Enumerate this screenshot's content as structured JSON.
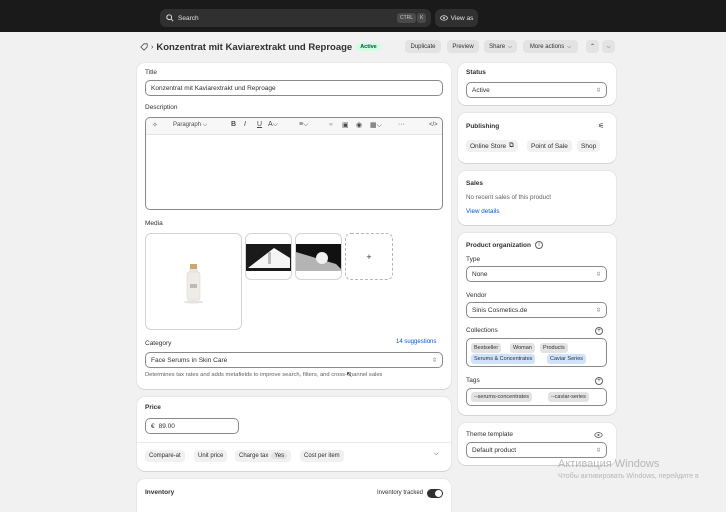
{
  "topbar": {
    "search_placeholder": "Search",
    "shortcut_ctrl": "CTRL",
    "shortcut_k": "K",
    "view_as": "View as"
  },
  "header": {
    "title": "Konzentrat mit Kaviarextrakt und Reproage",
    "status_badge": "Active",
    "duplicate": "Duplicate",
    "preview": "Preview",
    "share": "Share",
    "more_actions": "More actions"
  },
  "main": {
    "title_label": "Title",
    "title_value": "Konzentrat mit Kaviarextrakt und Reproage",
    "description_label": "Description",
    "paragraph": "Paragraph",
    "media_label": "Media",
    "add_media": "+",
    "category_label": "Category",
    "suggestions": "14 suggestions",
    "category_value": "Face Serums",
    "category_in": "in",
    "category_parent": "Skin Care",
    "category_help": "Determines tax rates and adds metafields to improve search, filters, and cross-channel sales",
    "price_label": "Price",
    "price_currency": "€",
    "price_value": "89.00",
    "chips": [
      "Compare-at",
      "Unit price",
      "Charge tax",
      "Cost per item"
    ],
    "charge_tax_value": "Yes",
    "inventory_label": "Inventory",
    "inventory_tracked": "Inventory tracked",
    "inventory_tracked_on": true
  },
  "side": {
    "status_label": "Status",
    "status_value": "Active",
    "publishing_label": "Publishing",
    "channels": [
      "Online Store",
      "Point of Sale",
      "Shop"
    ],
    "sales_label": "Sales",
    "sales_text": "No recent sales of this product",
    "view_details": "View details",
    "org_label": "Product organization",
    "type_label": "Type",
    "type_value": "None",
    "vendor_label": "Vendor",
    "vendor_value": "Sinis Cosmetics.de",
    "collections_label": "Collections",
    "collections": [
      "Bestseller",
      "Woman",
      "Products",
      "Serums & Concentrates",
      "Caviar Series"
    ],
    "tags_label": "Tags",
    "tags": [
      "--serums-concentrates",
      "--caviar-series"
    ],
    "theme_label": "Theme template",
    "theme_value": "Default product"
  },
  "watermark": {
    "line1": "Активация Windows",
    "line2": "Чтобы активировать Windows, перейдите в"
  },
  "colors": {
    "accent": "#005bd3",
    "active_badge": "#cdfee1",
    "topbar": "#1a1a1a"
  }
}
